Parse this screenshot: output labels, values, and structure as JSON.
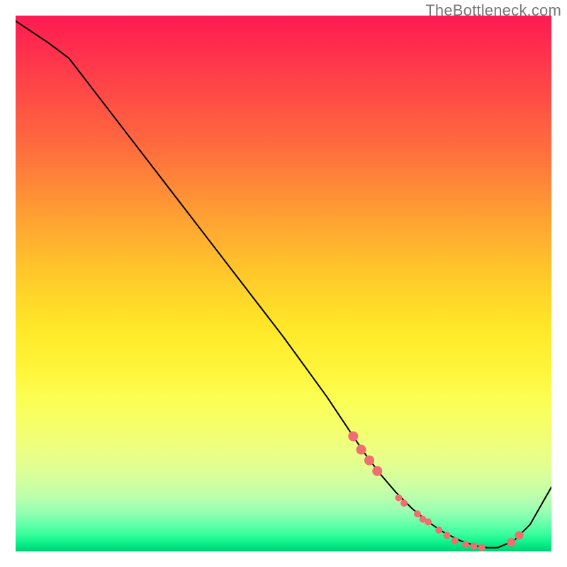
{
  "watermark": "TheBottleneck.com",
  "chart_data": {
    "type": "line",
    "title": "",
    "xlabel": "",
    "ylabel": "",
    "xlim": [
      0,
      100
    ],
    "ylim": [
      0,
      100
    ],
    "series": [
      {
        "name": "curve",
        "color": "#000000",
        "x": [
          0,
          6,
          8,
          10,
          20,
          30,
          40,
          50,
          58,
          62,
          65,
          68,
          71,
          74,
          77,
          80,
          83,
          86,
          88,
          90,
          93,
          96,
          100
        ],
        "y": [
          99,
          95,
          93.5,
          92,
          79,
          66,
          53,
          40,
          29,
          23,
          18.5,
          14.5,
          11,
          8,
          5.5,
          3.5,
          2,
          1,
          0.7,
          0.7,
          2,
          5,
          12
        ]
      }
    ],
    "scatter": {
      "name": "highlighted-points",
      "color": "#ef6e6e",
      "radius_primary": 7,
      "radius_secondary": 5,
      "points": [
        {
          "x": 63.0,
          "y": 21.5,
          "r": 7
        },
        {
          "x": 64.5,
          "y": 19.0,
          "r": 7
        },
        {
          "x": 66.0,
          "y": 17.0,
          "r": 7
        },
        {
          "x": 67.5,
          "y": 15.0,
          "r": 7
        },
        {
          "x": 71.5,
          "y": 10.0,
          "r": 5
        },
        {
          "x": 72.5,
          "y": 9.0,
          "r": 5
        },
        {
          "x": 75.0,
          "y": 7.0,
          "r": 5
        },
        {
          "x": 76.0,
          "y": 6.0,
          "r": 5
        },
        {
          "x": 77.0,
          "y": 5.5,
          "r": 5
        },
        {
          "x": 79.0,
          "y": 4.0,
          "r": 5
        },
        {
          "x": 80.5,
          "y": 3.0,
          "r": 5
        },
        {
          "x": 82.0,
          "y": 2.0,
          "r": 5
        },
        {
          "x": 84.0,
          "y": 1.3,
          "r": 5
        },
        {
          "x": 85.5,
          "y": 1.0,
          "r": 5
        },
        {
          "x": 87.0,
          "y": 0.7,
          "r": 5
        },
        {
          "x": 92.5,
          "y": 1.7,
          "r": 6
        },
        {
          "x": 94.0,
          "y": 3.0,
          "r": 6
        }
      ]
    }
  }
}
